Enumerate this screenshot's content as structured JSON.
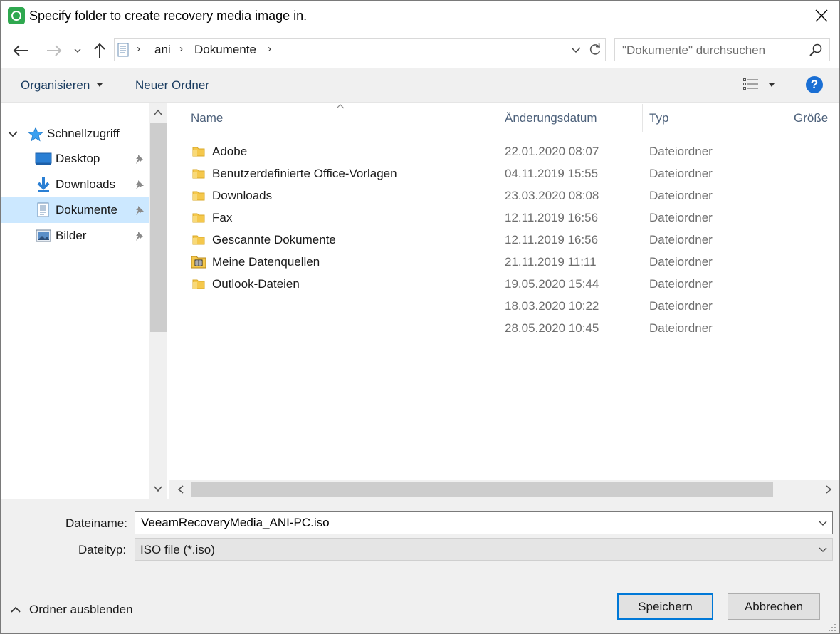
{
  "window": {
    "title": "Specify folder to create recovery media image in."
  },
  "address": {
    "crumbs": [
      "ani",
      "Dokumente"
    ]
  },
  "search": {
    "placeholder": "\"Dokumente\" durchsuchen"
  },
  "toolbar": {
    "organize_label": "Organisieren",
    "new_folder_label": "Neuer Ordner",
    "help_label": "?"
  },
  "sidebar": {
    "quick_access_label": "Schnellzugriff",
    "items": [
      {
        "label": "Desktop",
        "icon": "desktop-icon",
        "pinned": true
      },
      {
        "label": "Downloads",
        "icon": "download-arrow-icon",
        "pinned": true
      },
      {
        "label": "Dokumente",
        "icon": "document-icon",
        "pinned": true,
        "selected": true
      },
      {
        "label": "Bilder",
        "icon": "picture-icon",
        "pinned": true
      }
    ]
  },
  "file_list": {
    "columns": [
      "Name",
      "Änderungsdatum",
      "Typ",
      "Größe"
    ],
    "rows": [
      {
        "name": "Adobe",
        "date": "22.01.2020 08:07",
        "type": "Dateiordner",
        "icon": "folder-icon"
      },
      {
        "name": "Benutzerdefinierte Office-Vorlagen",
        "date": "04.11.2019 15:55",
        "type": "Dateiordner",
        "icon": "folder-icon"
      },
      {
        "name": "Downloads",
        "date": "23.03.2020 08:08",
        "type": "Dateiordner",
        "icon": "folder-icon"
      },
      {
        "name": "Fax",
        "date": "12.11.2019 16:56",
        "type": "Dateiordner",
        "icon": "folder-icon"
      },
      {
        "name": "Gescannte Dokumente",
        "date": "12.11.2019 16:56",
        "type": "Dateiordner",
        "icon": "folder-icon"
      },
      {
        "name": "Meine Datenquellen",
        "date": "21.11.2019 11:11",
        "type": "Dateiordner",
        "icon": "datasource-folder-icon"
      },
      {
        "name": "Outlook-Dateien",
        "date": "19.05.2020 15:44",
        "type": "Dateiordner",
        "icon": "folder-icon"
      },
      {
        "name": "",
        "date": "18.03.2020 10:22",
        "type": "Dateiordner",
        "icon": ""
      },
      {
        "name": "",
        "date": "28.05.2020 10:45",
        "type": "Dateiordner",
        "icon": ""
      }
    ]
  },
  "footer": {
    "filename_label": "Dateiname:",
    "filename_value": "VeeamRecoveryMedia_ANI-PC.iso",
    "filetype_label": "Dateityp:",
    "filetype_value": "ISO file (*.iso)",
    "hide_folders_label": "Ordner ausblenden",
    "save_label": "Speichern",
    "cancel_label": "Abbrechen"
  },
  "colors": {
    "accent": "#0078d7",
    "selection": "#cce8ff",
    "folder": "#f5c84c",
    "help": "#1a6fd4"
  }
}
